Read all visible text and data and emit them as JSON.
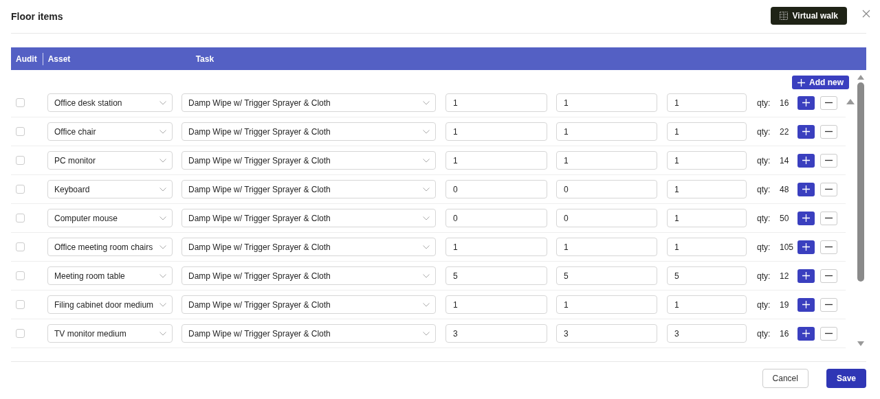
{
  "dialog": {
    "title": "Floor items",
    "virtual_walk_button": "Virtual walk"
  },
  "table": {
    "columns": [
      "Audit",
      "Asset",
      "Task"
    ],
    "add_new_button": "Add new",
    "rows": [
      {
        "checked": false,
        "asset": "Office desk station",
        "task": "Damp Wipe w/ Trigger Sprayer & Cloth",
        "value_1": "1",
        "value_2": "1",
        "value_3": "1",
        "qty_label": "qty:",
        "qty": "16"
      },
      {
        "checked": false,
        "asset": "Office chair",
        "task": "Damp Wipe w/ Trigger Sprayer & Cloth",
        "value_1": "1",
        "value_2": "1",
        "value_3": "1",
        "qty_label": "qty:",
        "qty": "22"
      },
      {
        "checked": false,
        "asset": "PC monitor",
        "task": "Damp Wipe w/ Trigger Sprayer & Cloth",
        "value_1": "1",
        "value_2": "1",
        "value_3": "1",
        "qty_label": "qty:",
        "qty": "14"
      },
      {
        "checked": false,
        "asset": "Keyboard",
        "task": "Damp Wipe w/ Trigger Sprayer & Cloth",
        "value_1": "0",
        "value_2": "0",
        "value_3": "1",
        "qty_label": "qty:",
        "qty": "48"
      },
      {
        "checked": false,
        "asset": "Computer mouse",
        "task": "Damp Wipe w/ Trigger Sprayer & Cloth",
        "value_1": "0",
        "value_2": "0",
        "value_3": "1",
        "qty_label": "qty:",
        "qty": "50"
      },
      {
        "checked": false,
        "asset": "Office meeting room chairs",
        "task": "Damp Wipe w/ Trigger Sprayer & Cloth",
        "value_1": "1",
        "value_2": "1",
        "value_3": "1",
        "qty_label": "qty:",
        "qty": "105"
      },
      {
        "checked": false,
        "asset": "Meeting room table",
        "task": "Damp Wipe w/ Trigger Sprayer & Cloth",
        "value_1": "5",
        "value_2": "5",
        "value_3": "5",
        "qty_label": "qty:",
        "qty": "12"
      },
      {
        "checked": false,
        "asset": "Filing cabinet door medium",
        "task": "Damp Wipe w/ Trigger Sprayer & Cloth",
        "value_1": "1",
        "value_2": "1",
        "value_3": "1",
        "qty_label": "qty:",
        "qty": "19"
      },
      {
        "checked": false,
        "asset": "TV monitor medium",
        "task": "Damp Wipe w/ Trigger Sprayer & Cloth",
        "value_1": "3",
        "value_2": "3",
        "value_3": "3",
        "qty_label": "qty:",
        "qty": "16"
      }
    ]
  },
  "footer": {
    "cancel_button": "Cancel",
    "save_button": "Save"
  }
}
